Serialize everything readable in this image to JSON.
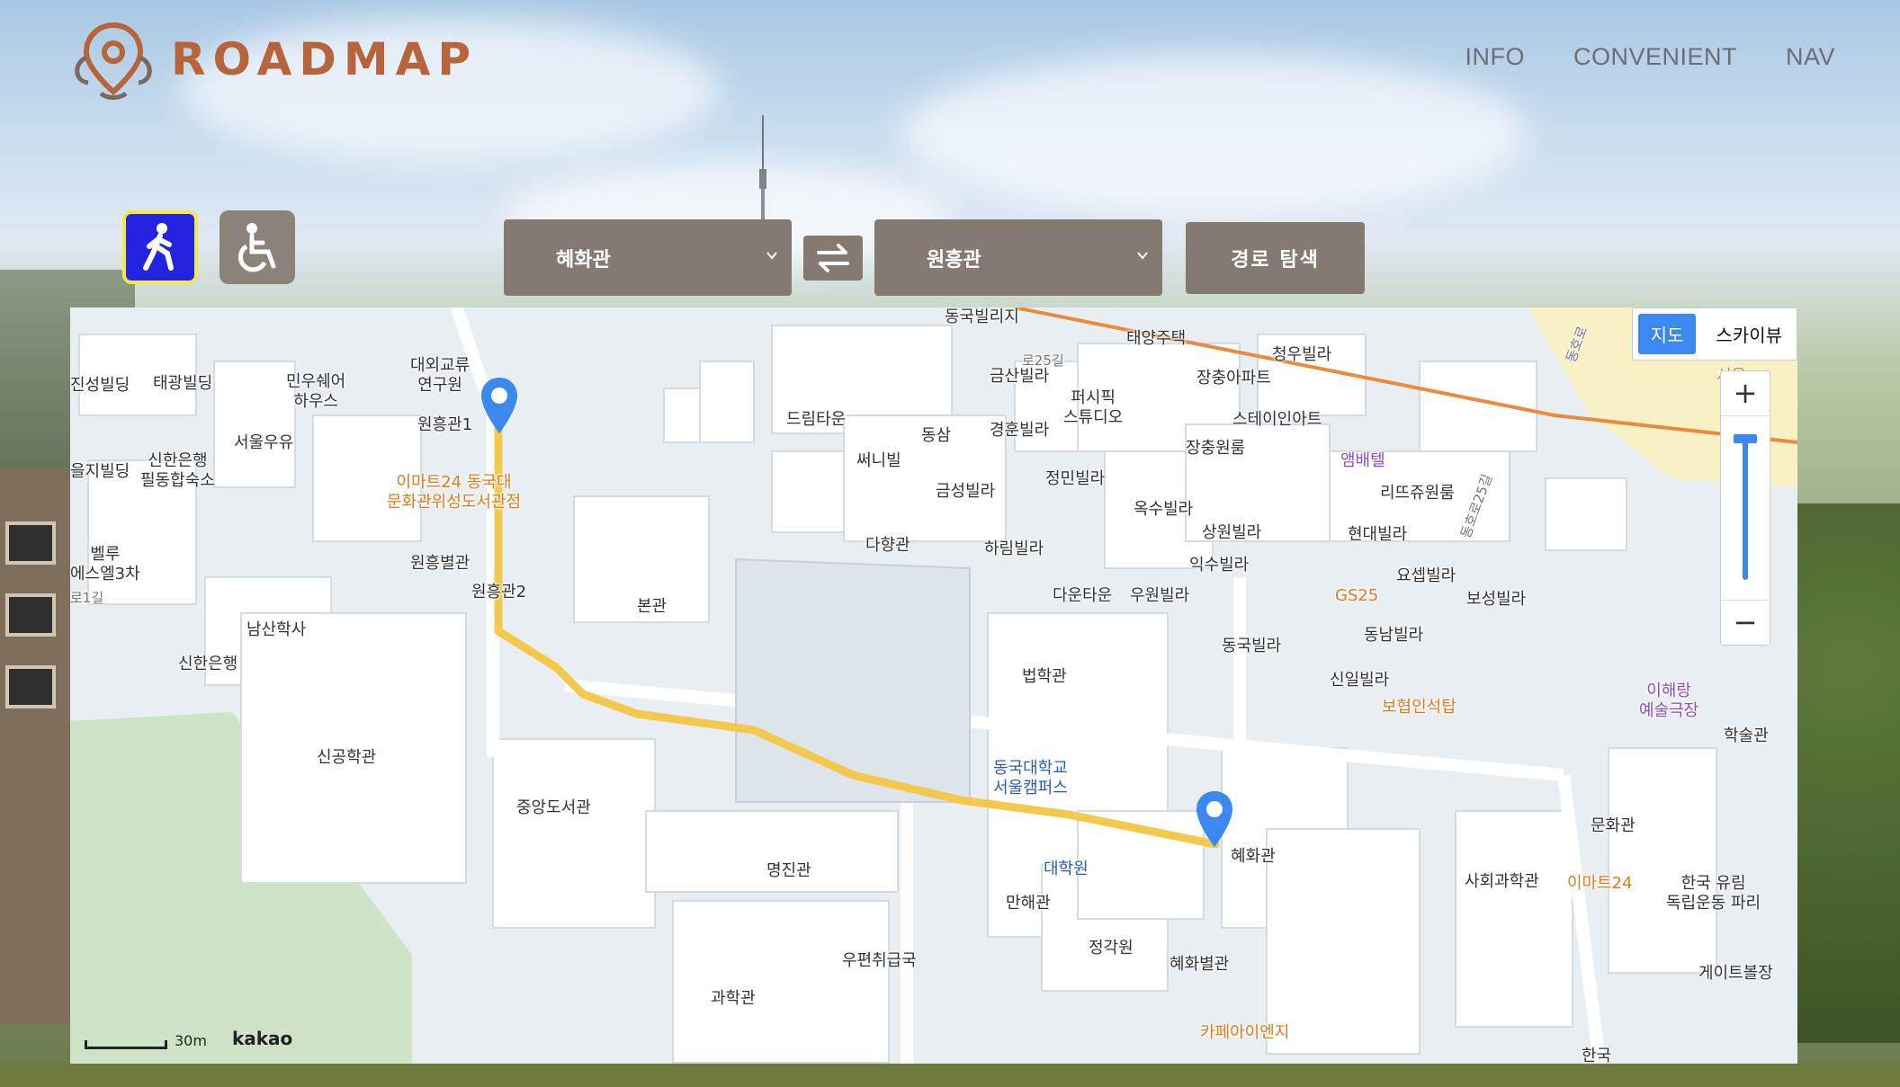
{
  "brand": {
    "name": "ROADMAP"
  },
  "nav": {
    "items": [
      "INFO",
      "CONVENIENT",
      "NAV"
    ]
  },
  "modes": {
    "walk": {
      "icon": "pedestrian-icon",
      "selected": true
    },
    "wheelchair": {
      "icon": "wheelchair-icon",
      "selected": false
    }
  },
  "route": {
    "origin": "혜화관",
    "destination": "원흥관",
    "swap_icon": "swap-arrows-icon",
    "search_label": "경로 탐색"
  },
  "map": {
    "type_options": [
      "지도",
      "스카이뷰"
    ],
    "selected_type": "지도",
    "zoom_in": "+",
    "zoom_out": "−",
    "scale": "30m",
    "provider": "kakao",
    "route_color": "#f2c94c",
    "labels": {
      "jinseong": "진성빌딩",
      "taegwang": "태광빌딩",
      "minwoo": "민우쉐어\n하우스",
      "daeoe": "대외교류\n연구원",
      "wonheung1": "원흥관1",
      "seoulwoo": "서울우유",
      "euljiro": "을지빌딩",
      "shinhan_dorm": "신한은행\n필동합숙소",
      "emart_dongguk": "이마트24 동국대\n문화관위성도서관점",
      "wonheungbyul": "원흥별관",
      "wonheung2": "원흥관2",
      "bellu": "벨루\n에스엘3차",
      "ro1gil": "로1길",
      "namsan": "남산학사",
      "shinhan_bank": "신한은행",
      "singong": "신공학관",
      "jungang_lib": "중앙도서관",
      "bongwan": "본관",
      "dreamtown": "드림타운",
      "sunny": "써니빌",
      "dongsam": "동삼",
      "geumsan": "금산빌라",
      "peoship": "퍼시픽\n스튜디오",
      "gyeonghun": "경훈빌라",
      "jeongmin": "정민빌라",
      "geumseong": "금성빌라",
      "dahyang": "다향관",
      "harim": "하림빌라",
      "dongguk_villa": "동국빌리지",
      "taeyang": "태양주택",
      "cheongwoo": "청우빌라",
      "jangchung_apt": "장충아파트",
      "stay": "스테이인아트",
      "jangchung_one": "장충원룸",
      "ambatel": "앰배텔",
      "rimjew": "리뜨쥬원룸",
      "okso": "옥수빌라",
      "sangwon": "상원빌라",
      "hyundai": "현대빌라",
      "iksu": "익수빌라",
      "downtown": "다운타운",
      "uwon": "우원빌라",
      "gs25": "GS25",
      "yoseong": "요셉빌라",
      "boseong": "보성빌라",
      "dongnam": "동남빌라",
      "dongguk_villa2": "동국빌라",
      "shinil": "신일빌라",
      "bohyeop": "보협인석탑",
      "beophak": "법학관",
      "univ": "동국대학교\n서울캠퍼스",
      "daehakwon": "대학원",
      "manhae": "만해관",
      "jeonggak": "정각원",
      "hyehwa": "혜화관",
      "hyehwa_byul": "혜화별관",
      "cafe": "카페아이엔지",
      "myeongjin": "명진관",
      "post": "우편취급국",
      "science": "과학관",
      "ihaerang": "이해랑\n예술극장",
      "haksul": "학술관",
      "munhwa": "문화관",
      "social": "사회과학관",
      "emart24": "이마트24",
      "korea_park": "한국 유림\n독립운동 파리",
      "gate": "게이트볼장",
      "road25": "로25길",
      "road252": "동호로25길",
      "seoul_bottom": "한국",
      "dongho": "동호로",
      "seoul_r": "서울"
    }
  }
}
